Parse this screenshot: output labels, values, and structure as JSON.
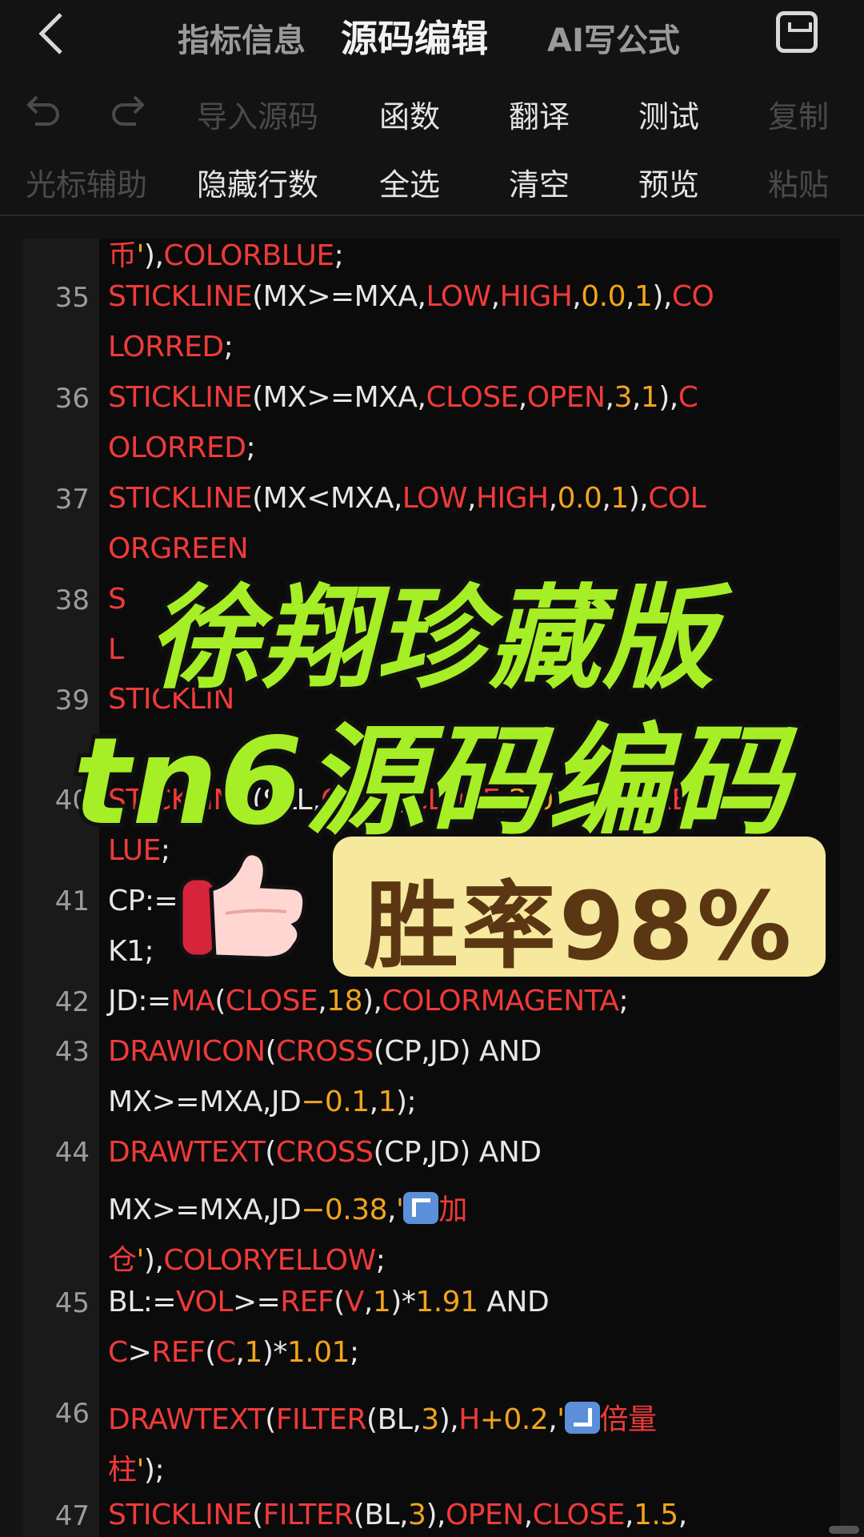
{
  "header": {
    "tabs": [
      {
        "label": "指标信息"
      },
      {
        "label": "源码编辑"
      },
      {
        "label": "AI写公式"
      }
    ]
  },
  "toolbar": {
    "row1": [
      "导入源码",
      "函数",
      "翻译",
      "测试",
      "复制"
    ],
    "row2": [
      "光标辅助",
      "隐藏行数",
      "全选",
      "清空",
      "预览",
      "粘贴"
    ]
  },
  "editor": {
    "line_numbers": [
      "35",
      "36",
      "37",
      "38",
      "39",
      "40",
      "41",
      "42",
      "43",
      "44",
      "45",
      "46",
      "47"
    ]
  },
  "overlay": {
    "title1": "徐翔珍藏版",
    "title2": "tn6源码编码",
    "badge": "胜率98%"
  },
  "colors": {
    "keyword_red": "#f03a3a",
    "number_orange": "#f0a41d",
    "text_white": "#e6e6e6",
    "accent_green": "#a6ee25",
    "badge_bg": "#f6e89d",
    "badge_text": "#5a3712"
  }
}
